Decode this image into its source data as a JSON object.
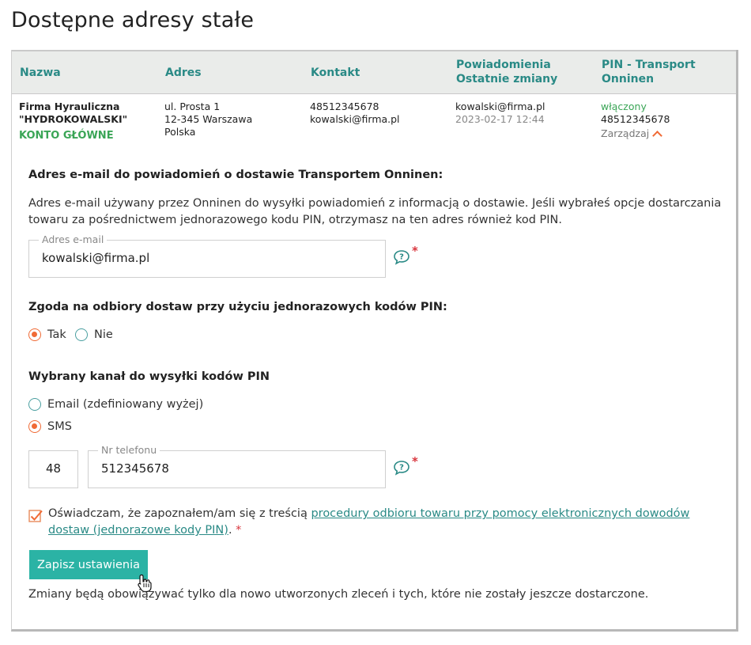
{
  "page": {
    "title": "Dostępne adresy stałe"
  },
  "table": {
    "headers": {
      "name": "Nazwa",
      "address": "Adres",
      "contact": "Kontakt",
      "notifications_line1": "Powiadomienia",
      "notifications_line2": "Ostatnie zmiany",
      "pin_line1": "PIN - Transport",
      "pin_line2": "Onninen"
    },
    "row": {
      "name_line1": "Firma Hyrauliczna",
      "name_line2": "\"HYDROKOWALSKI\"",
      "account_badge": "KONTO GŁÓWNE",
      "address_line1": "ul. Prosta 1",
      "address_line2": "12-345 Warszawa",
      "address_line3": "Polska",
      "contact_phone": "48512345678",
      "contact_email": "kowalski@firma.pl",
      "notify_email": "kowalski@firma.pl",
      "last_change": "2023-02-17 12:44",
      "pin_status": "włączony",
      "pin_phone": "48512345678",
      "manage_label": "Zarządzaj"
    }
  },
  "email_section": {
    "heading": "Adres e-mail do powiadomień o dostawie Transportem Onninen:",
    "description": "Adres e-mail używany przez Onninen do wysyłki powiadomień z informacją o dostawie. Jeśli wybrałeś opcje dostarczania towaru za pośrednictwem jednorazowego kodu PIN, otrzymasz na ten adres również kod PIN.",
    "field_label": "Adres e-mail",
    "field_value": "kowalski@firma.pl",
    "required_mark": "*"
  },
  "consent_section": {
    "heading": "Zgoda na odbiory dostaw przy użyciu jednorazowych kodów PIN:",
    "options": [
      "Tak",
      "Nie"
    ],
    "selected": "Tak"
  },
  "channel_section": {
    "heading": "Wybrany kanał do wysyłki kodów PIN",
    "options": [
      "Email (zdefiniowany wyżej)",
      "SMS"
    ],
    "selected": "SMS",
    "prefix_value": "48",
    "phone_label": "Nr telefonu",
    "phone_value": "512345678",
    "required_mark": "*"
  },
  "declaration": {
    "checked": true,
    "text_before": "Oświadczam, że zapoznałem/am się z treścią ",
    "link_text": "procedury odbioru towaru przy pomocy elektronicznych dowodów dostaw (jednorazowe kody PIN)",
    "text_after": ". ",
    "required_mark": "*"
  },
  "actions": {
    "save_label": "Zapisz ustawienia",
    "note": "Zmiany będą obowiązywać tylko dla nowo utworzonych zleceń i tych, które nie zostały jeszcze dostarczone."
  },
  "colors": {
    "accent_teal": "#2bb3a5",
    "header_teal": "#2a8a86",
    "radio_orange": "#f06a35",
    "required_red": "#d9363e",
    "badge_green": "#3aa556"
  },
  "icons": {
    "help": "help-bubble-icon",
    "manage_chevron": "chevron-up-icon",
    "cursor": "hand-cursor-icon"
  }
}
